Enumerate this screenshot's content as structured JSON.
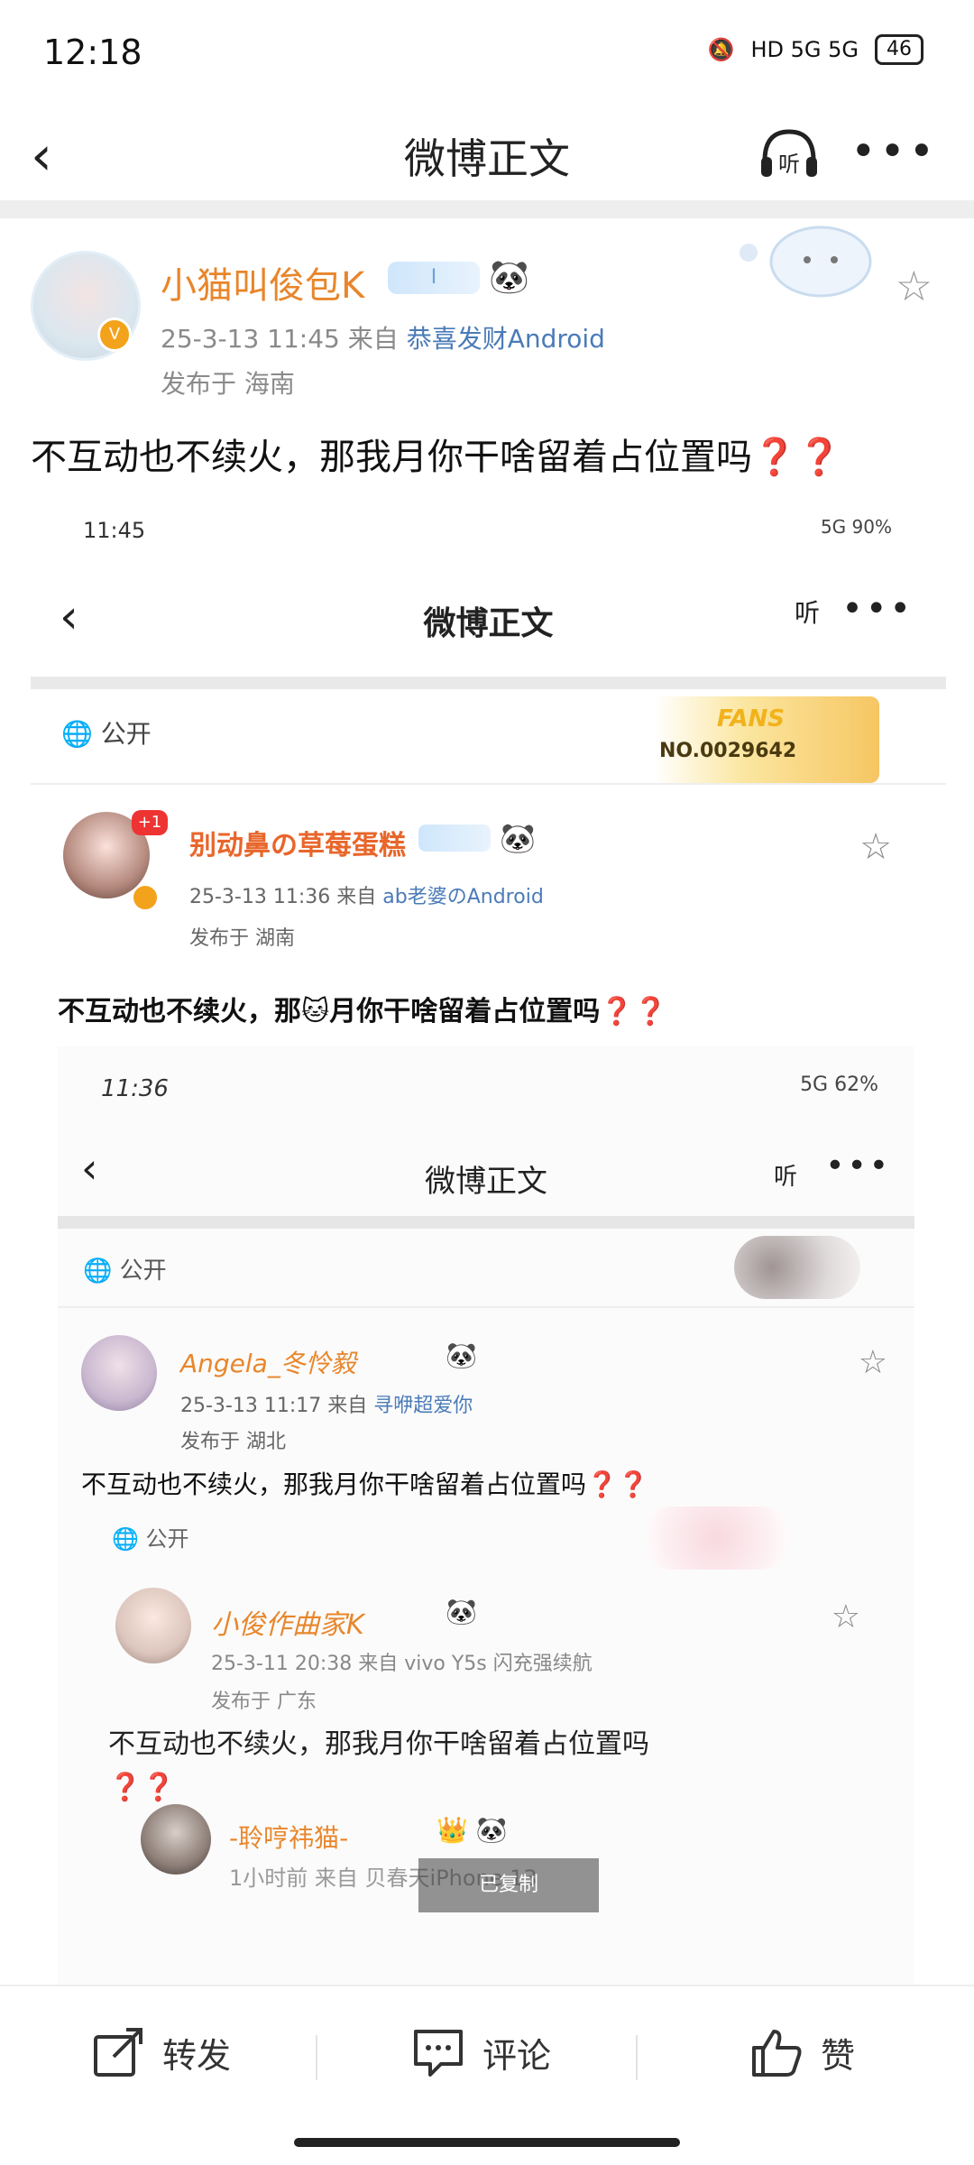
{
  "status_bar": {
    "time": "12:18",
    "network": "HD 5G 5G",
    "battery": "46"
  },
  "nav": {
    "title": "微博正文",
    "listen_label": "听"
  },
  "post": {
    "username": "小猫叫俊包K",
    "level_badge": "I",
    "timestamp": "25-3-13 11:45",
    "from_label": "来自",
    "source": "恭喜发财Android",
    "location": "发布于 海南",
    "text": "不互动也不续火，那我月你干啥留着占位置吗",
    "question_marks": "❓❓"
  },
  "embedded": {
    "time": "11:45",
    "status_icons": "5G 90%",
    "nav_title": "微博正文",
    "listen_label": "听",
    "public_label": "公开",
    "fans_label": "FANS",
    "fans_number": "NO.0029642",
    "username": "别动鼻の草莓蛋糕",
    "plus_badge": "+1",
    "level_badge": "I",
    "timestamp": "25-3-13 11:36",
    "from_label": "来自",
    "source": "ab老婆のAndroid",
    "location": "发布于 湖南",
    "text": "不互动也不续火，那🐱月你干啥留着占位置吗",
    "question_marks": "❓❓"
  },
  "embedded2": {
    "time": "11:36",
    "status_icons": "5G 62%",
    "nav_title": "微博正文",
    "listen_label": "听",
    "public_label": "公开",
    "username": "Angela_冬怜毅",
    "timestamp": "25-3-13 11:17",
    "from_label": "来自",
    "source": "寻咿超爱你",
    "location": "发布于 湖北",
    "text": "不互动也不续火，那我月你干啥留着占位置吗",
    "question_marks": "❓❓",
    "public_label2": "公开",
    "reply_username": "小俊作曲家K",
    "reply_timestamp": "25-3-11 20:38",
    "reply_source": "来自 vivo Y5s 闪充强续航",
    "reply_location": "发布于 广东",
    "reply_text": "不互动也不续火，那我月你干啥留着占位置吗",
    "reply_question_marks": "❓❓",
    "third_username": "-聆哼祎猫-",
    "third_meta": "1小时前  来自 贝春天iPhone 13",
    "overlay_label": "已复制"
  },
  "toolbar": {
    "repost_label": "转发",
    "comment_label": "评论",
    "like_label": "赞"
  }
}
